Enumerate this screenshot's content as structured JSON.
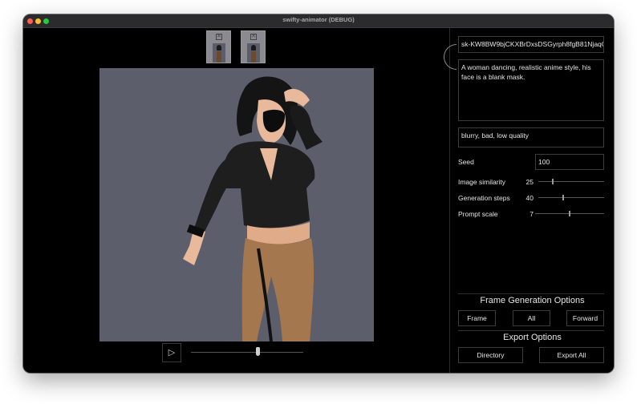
{
  "window": {
    "title": "swifty-animator (DEBUG)"
  },
  "thumbnails": [
    {
      "close_glyph": "✕"
    },
    {
      "close_glyph": "✕"
    }
  ],
  "canvas": {
    "description_icon": "generated-frame-image"
  },
  "playback": {
    "play_glyph": "▷",
    "progress": 0.59
  },
  "panel": {
    "api_key": "sk-KW8BW9bjCKXBrDxsDSGyrph8fgB81NjaqO",
    "prompt": "A woman dancing, realistic anime style, his face is a blank mask.",
    "negative_prompt": "blurry, bad, low quality",
    "seed_label": "Seed",
    "seed_value": "100",
    "sliders": [
      {
        "label": "Image similarity",
        "value": "25",
        "fraction": 0.22
      },
      {
        "label": "Generation steps",
        "value": "40",
        "fraction": 0.38
      },
      {
        "label": "Prompt scale",
        "value": "7",
        "fraction": 0.5
      }
    ],
    "frame_options": {
      "title": "Frame Generation Options",
      "buttons": [
        "Frame",
        "All",
        "Forward"
      ]
    },
    "export_options": {
      "title": "Export Options",
      "buttons": [
        "Directory",
        "Export All"
      ]
    }
  },
  "colors": {
    "canvas_bg": "#5c5f6b",
    "window_bg": "#000000"
  }
}
